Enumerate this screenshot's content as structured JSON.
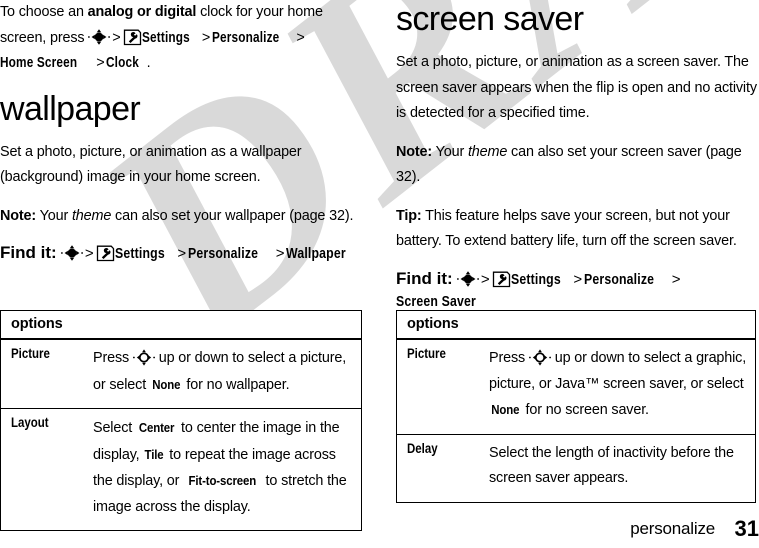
{
  "watermark": {
    "text": "DRAFT"
  },
  "icons": {
    "nav_key": "navigation-key-icon",
    "settings": "settings-wrench-icon",
    "nav_key_cell": "navigation-key-icon"
  },
  "left_column": {
    "intro": {
      "part1": "To choose an ",
      "bold1": "analog or digital",
      "part2": " clock for your home screen, press ",
      "path": [
        "Settings",
        "Personalize",
        "Home Screen",
        "Clock"
      ],
      "end": "."
    },
    "heading": "wallpaper",
    "paragraph": "Set a photo, picture, or animation as a wallpaper (background) image in your home screen.",
    "note": {
      "label": "Note:",
      "text_before": " Your ",
      "italic": "theme",
      "text_after": " can also set your wallpaper (page 32)."
    },
    "find_it": {
      "label": "Find it:",
      "path": [
        "Settings",
        "Personalize",
        "Wallpaper"
      ]
    },
    "table": {
      "header": "options",
      "rows": [
        {
          "key": "Picture",
          "value_parts": [
            {
              "t": "Press "
            },
            {
              "icon": "nav-key"
            },
            {
              "t": " up or down to select a picture, or select "
            },
            {
              "b": "None"
            },
            {
              "t": " for no wallpaper."
            }
          ]
        },
        {
          "key": "Layout",
          "value_parts": [
            {
              "t": "Select "
            },
            {
              "b": "Center"
            },
            {
              "t": " to center the image in the display, "
            },
            {
              "b": "Tile"
            },
            {
              "t": " to repeat the image across the display, or "
            },
            {
              "b": "Fit-to-screen"
            },
            {
              "t": " to stretch the image across the display."
            }
          ]
        }
      ]
    }
  },
  "right_column": {
    "heading": "screen saver",
    "paragraph": "Set a photo, picture, or animation as a screen saver. The screen saver appears when the flip is open and no activity is detected for a specified time.",
    "note": {
      "label": "Note:",
      "text_before": " Your ",
      "italic": "theme",
      "text_after": " can also set your screen saver (page 32)."
    },
    "tip": {
      "label": "Tip:",
      "text": " This feature helps save your screen, but not your battery. To extend battery life, turn off the screen saver."
    },
    "find_it": {
      "label": "Find it:",
      "path": [
        "Settings",
        "Personalize",
        "Screen Saver"
      ]
    },
    "table": {
      "header": "options",
      "rows": [
        {
          "key": "Picture",
          "value_parts": [
            {
              "t": "Press "
            },
            {
              "icon": "nav-key"
            },
            {
              "t": " up or down to select a graphic, picture, or Java™ screen saver, or select "
            },
            {
              "b": "None"
            },
            {
              "t": " for no screen saver."
            }
          ]
        },
        {
          "key": "Delay",
          "value_parts": [
            {
              "t": "Select the length of inactivity before the screen saver appears."
            }
          ]
        }
      ]
    }
  },
  "footer": {
    "section": "personalize",
    "page_number": "31"
  }
}
